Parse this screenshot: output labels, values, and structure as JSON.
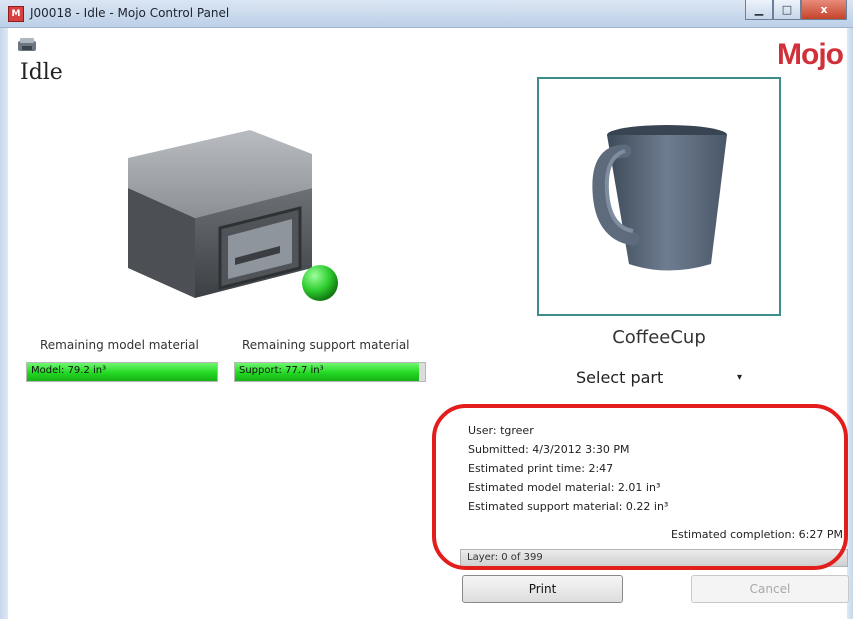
{
  "window": {
    "title": "J00018 - Idle - Mojo Control Panel",
    "app_icon": "M",
    "controls": {
      "minimize": "▁",
      "maximize": "□",
      "close": "x"
    }
  },
  "header": {
    "status": "Idle",
    "brand": "Mojo",
    "status_icon": "printer-icon"
  },
  "materials": {
    "model_label": "Remaining model material",
    "model_value": "Model: 79.2 in³",
    "model_level": 1.0,
    "support_label": "Remaining support material",
    "support_value": "Support: 77.7 in³",
    "support_level": 0.97
  },
  "part": {
    "name": "CoffeeCup",
    "select_label": "Select part",
    "select_arrow": "▾"
  },
  "job": {
    "user": "User: tgreer",
    "submitted": "Submitted: 4/3/2012 3:30 PM",
    "print_time": "Estimated print time: 2:47",
    "model_material": "Estimated model material: 2.01 in³",
    "support_material": "Estimated support material: 0.22 in³",
    "completion": "Estimated completion:  6:27 PM",
    "layer": "Layer: 0 of 399"
  },
  "buttons": {
    "print": "Print",
    "cancel": "Cancel"
  },
  "colors": {
    "brand": "#d0303a",
    "status_light": "#2ecc2e",
    "material_bar": "#23d823",
    "annotation": "#e31c1c",
    "preview_border": "#3e8c8c"
  }
}
